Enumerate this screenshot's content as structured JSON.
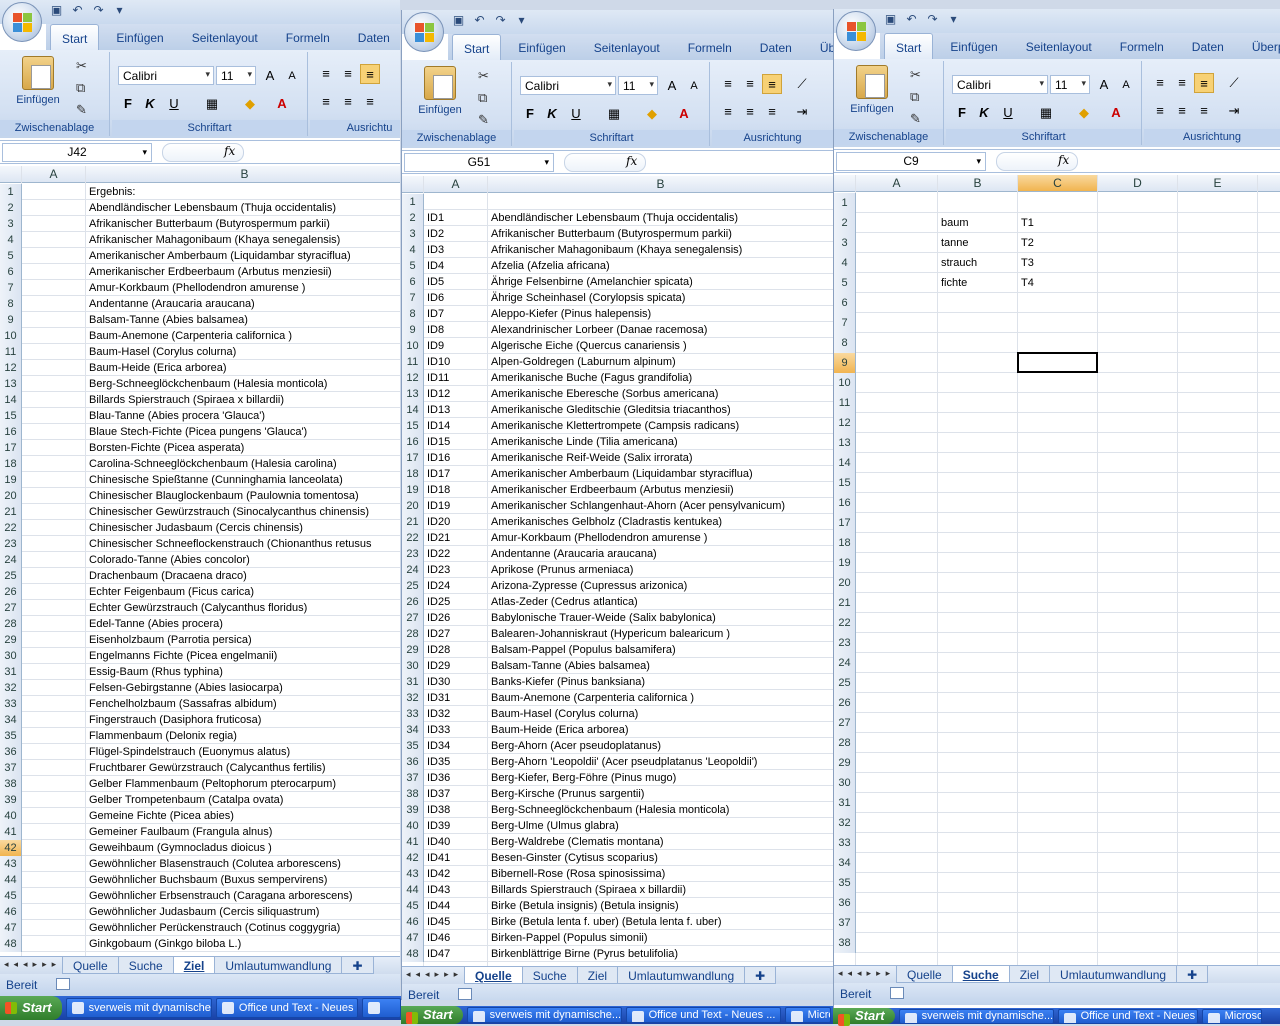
{
  "ribbon_tabs_1": [
    "Start",
    "Einfügen",
    "Seitenlayout",
    "Formeln",
    "Daten"
  ],
  "ribbon_tabs_2": [
    "Start",
    "Einfügen",
    "Seitenlayout",
    "Formeln",
    "Daten",
    "Übe"
  ],
  "ribbon_tabs_3": [
    "Start",
    "Einfügen",
    "Seitenlayout",
    "Formeln",
    "Daten",
    "Überp"
  ],
  "ribbon": {
    "paste_label": "Einfügen",
    "clipboard_group": "Zwischenablage",
    "font_group": "Schriftart",
    "align_group": "Ausrichtung",
    "align_group_short": "Ausrichtu",
    "font_name": "Calibri",
    "font_size": "11",
    "bold": "F",
    "italic": "K",
    "underline": "U"
  },
  "fx_label": "fx",
  "window1": {
    "namebox": "J42",
    "columns": [
      "A",
      "B"
    ],
    "rows": [
      [
        "",
        "Ergebnis:"
      ],
      [
        "",
        "Abendländischer Lebensbaum (Thuja occidentalis)"
      ],
      [
        "",
        "Afrikanischer Butterbaum (Butyrospermum parkii)"
      ],
      [
        "",
        "Afrikanischer Mahagonibaum (Khaya senegalensis)"
      ],
      [
        "",
        "Amerikanischer Amberbaum (Liquidambar styraciflua)"
      ],
      [
        "",
        "Amerikanischer Erdbeerbaum (Arbutus menziesii)"
      ],
      [
        "",
        "Amur-Korkbaum (Phellodendron amurense )"
      ],
      [
        "",
        "Andentanne (Araucaria araucana)"
      ],
      [
        "",
        "Balsam-Tanne (Abies balsamea)"
      ],
      [
        "",
        "Baum-Anemone (Carpenteria californica )"
      ],
      [
        "",
        "Baum-Hasel (Corylus colurna)"
      ],
      [
        "",
        "Baum-Heide (Erica arborea)"
      ],
      [
        "",
        "Berg-Schneeglöckchenbaum (Halesia monticola)"
      ],
      [
        "",
        "Billards Spierstrauch (Spiraea x billardii)"
      ],
      [
        "",
        "Blau-Tanne (Abies procera 'Glauca')"
      ],
      [
        "",
        "Blaue Stech-Fichte (Picea pungens 'Glauca')"
      ],
      [
        "",
        "Borsten-Fichte (Picea asperata)"
      ],
      [
        "",
        "Carolina-Schneeglöckchenbaum (Halesia carolina)"
      ],
      [
        "",
        "Chinesische Spießtanne (Cunninghamia lanceolata)"
      ],
      [
        "",
        "Chinesischer Blauglockenbaum (Paulownia tomentosa)"
      ],
      [
        "",
        "Chinesischer Gewürzstrauch (Sinocalycanthus chinensis)"
      ],
      [
        "",
        "Chinesischer Judasbaum (Cercis chinensis)"
      ],
      [
        "",
        "Chinesischer Schneeflockenstrauch (Chionanthus retusus"
      ],
      [
        "",
        "Colorado-Tanne (Abies concolor)"
      ],
      [
        "",
        "Drachenbaum (Dracaena draco)"
      ],
      [
        "",
        "Echter Feigenbaum (Ficus carica)"
      ],
      [
        "",
        "Echter Gewürzstrauch (Calycanthus floridus)"
      ],
      [
        "",
        "Edel-Tanne (Abies procera)"
      ],
      [
        "",
        "Eisenholzbaum (Parrotia persica)"
      ],
      [
        "",
        "Engelmanns Fichte (Picea engelmanii)"
      ],
      [
        "",
        "Essig-Baum (Rhus typhina)"
      ],
      [
        "",
        "Felsen-Gebirgstanne (Abies lasiocarpa)"
      ],
      [
        "",
        "Fenchelholzbaum (Sassafras albidum)"
      ],
      [
        "",
        "Fingerstrauch (Dasiphora fruticosa)"
      ],
      [
        "",
        "Flammenbaum (Delonix regia)"
      ],
      [
        "",
        "Flügel-Spindelstrauch (Euonymus alatus)"
      ],
      [
        "",
        "Fruchtbarer Gewürzstrauch (Calycanthus fertilis)"
      ],
      [
        "",
        "Gelber Flammenbaum (Peltophorum pterocarpum)"
      ],
      [
        "",
        "Gelber Trompetenbaum (Catalpa ovata)"
      ],
      [
        "",
        "Gemeine Fichte (Picea abies)"
      ],
      [
        "",
        "Gemeiner Faulbaum (Frangula alnus)"
      ],
      [
        "",
        "Geweihbaum (Gymnocladus dioicus )"
      ],
      [
        "",
        "Gewöhnlicher Blasenstrauch (Colutea arborescens)"
      ],
      [
        "",
        "Gewöhnlicher Buchsbaum (Buxus sempervirens)"
      ],
      [
        "",
        "Gewöhnlicher Erbsenstrauch (Caragana arborescens)"
      ],
      [
        "",
        "Gewöhnlicher Judasbaum (Cercis siliquastrum)"
      ],
      [
        "",
        "Gewöhnlicher Perückenstrauch (Cotinus coggygria)"
      ],
      [
        "",
        "Ginkgobaum (Ginkgo biloba L.)"
      ]
    ],
    "sheet_tabs": [
      "Quelle",
      "Suche",
      "Ziel",
      "Umlautumwandlung"
    ],
    "active_tab": "Ziel"
  },
  "window2": {
    "namebox": "G51",
    "columns": [
      "A",
      "B"
    ],
    "rows": [
      [
        "",
        ""
      ],
      [
        "ID1",
        "Abendländischer Lebensbaum (Thuja occidentalis)"
      ],
      [
        "ID2",
        "Afrikanischer Butterbaum (Butyrospermum parkii)"
      ],
      [
        "ID3",
        "Afrikanischer Mahagonibaum (Khaya senegalensis)"
      ],
      [
        "ID4",
        "Afzelia (Afzelia africana)"
      ],
      [
        "ID5",
        "Ährige Felsenbirne (Amelanchier spicata)"
      ],
      [
        "ID6",
        "Ährige Scheinhasel (Corylopsis spicata)"
      ],
      [
        "ID7",
        "Aleppo-Kiefer (Pinus halepensis)"
      ],
      [
        "ID8",
        "Alexandrinischer Lorbeer (Danae racemosa)"
      ],
      [
        "ID9",
        "Algerische Eiche (Quercus canariensis )"
      ],
      [
        "ID10",
        "Alpen-Goldregen (Laburnum alpinum)"
      ],
      [
        "ID11",
        "Amerikanische Buche (Fagus grandifolia)"
      ],
      [
        "ID12",
        "Amerikanische Eberesche (Sorbus americana)"
      ],
      [
        "ID13",
        "Amerikanische Gleditschie (Gleditsia triacanthos)"
      ],
      [
        "ID14",
        "Amerikanische Klettertrompete (Campsis radicans)"
      ],
      [
        "ID15",
        "Amerikanische Linde (Tilia americana)"
      ],
      [
        "ID16",
        "Amerikanische Reif-Weide (Salix irrorata)"
      ],
      [
        "ID17",
        "Amerikanischer Amberbaum (Liquidambar styraciflua)"
      ],
      [
        "ID18",
        "Amerikanischer Erdbeerbaum (Arbutus menziesii)"
      ],
      [
        "ID19",
        "Amerikanischer Schlangenhaut-Ahorn (Acer pensylvanicum)"
      ],
      [
        "ID20",
        "Amerikanisches Gelbholz (Cladrastis kentukea)"
      ],
      [
        "ID21",
        "Amur-Korkbaum (Phellodendron amurense )"
      ],
      [
        "ID22",
        "Andentanne (Araucaria araucana)"
      ],
      [
        "ID23",
        "Aprikose (Prunus armeniaca)"
      ],
      [
        "ID24",
        "Arizona-Zypresse (Cupressus arizonica)"
      ],
      [
        "ID25",
        "Atlas-Zeder (Cedrus atlantica)"
      ],
      [
        "ID26",
        "Babylonische Trauer-Weide (Salix babylonica)"
      ],
      [
        "ID27",
        "Balearen-Johanniskraut (Hypericum balearicum )"
      ],
      [
        "ID28",
        "Balsam-Pappel (Populus balsamifera)"
      ],
      [
        "ID29",
        "Balsam-Tanne (Abies balsamea)"
      ],
      [
        "ID30",
        "Banks-Kiefer (Pinus banksiana)"
      ],
      [
        "ID31",
        "Baum-Anemone (Carpenteria californica )"
      ],
      [
        "ID32",
        "Baum-Hasel (Corylus colurna)"
      ],
      [
        "ID33",
        "Baum-Heide (Erica arborea)"
      ],
      [
        "ID34",
        "Berg-Ahorn (Acer pseudoplatanus)"
      ],
      [
        "ID35",
        "Berg-Ahorn 'Leopoldii' (Acer pseudplatanus 'Leopoldii')"
      ],
      [
        "ID36",
        "Berg-Kiefer, Berg-Föhre (Pinus mugo)"
      ],
      [
        "ID37",
        "Berg-Kirsche (Prunus sargentii)"
      ],
      [
        "ID38",
        "Berg-Schneeglöckchenbaum (Halesia monticola)"
      ],
      [
        "ID39",
        "Berg-Ulme (Ulmus glabra)"
      ],
      [
        "ID40",
        "Berg-Waldrebe (Clematis montana)"
      ],
      [
        "ID41",
        "Besen-Ginster (Cytisus scoparius)"
      ],
      [
        "ID42",
        "Bibernell-Rose (Rosa spinosissima)"
      ],
      [
        "ID43",
        "Billards Spierstrauch (Spiraea x billardii)"
      ],
      [
        "ID44",
        "Birke (Betula insignis) (Betula insignis)"
      ],
      [
        "ID45",
        "Birke (Betula lenta f. uber) (Betula lenta f. uber)"
      ],
      [
        "ID46",
        "Birken-Pappel (Populus simonii)"
      ],
      [
        "ID47",
        "Birkenblättrige Birne (Pyrus betulifolia)"
      ]
    ],
    "sheet_tabs": [
      "Quelle",
      "Suche",
      "Ziel",
      "Umlautumwandlung"
    ],
    "active_tab": "Quelle"
  },
  "window3": {
    "namebox": "C9",
    "columns": [
      "A",
      "B",
      "C",
      "D",
      "E"
    ],
    "rows": [
      [
        "",
        "",
        ""
      ],
      [
        "",
        "baum",
        "T1"
      ],
      [
        "",
        "tanne",
        "T2"
      ],
      [
        "",
        "strauch",
        "T3"
      ],
      [
        "",
        "fichte",
        "T4"
      ]
    ],
    "row_count": 38,
    "sheet_tabs": [
      "Quelle",
      "Suche",
      "Ziel",
      "Umlautumwandlung"
    ],
    "active_tab": "Suche"
  },
  "status_text": "Bereit",
  "taskbar": {
    "start": "Start",
    "items": [
      "sverweis mit dynamische...",
      "Office und Text - Neues ...",
      "Microsoft"
    ],
    "items_short": [
      "sverweis mit dynamische...",
      "Office und Text - Neues ...",
      "Micro"
    ]
  }
}
